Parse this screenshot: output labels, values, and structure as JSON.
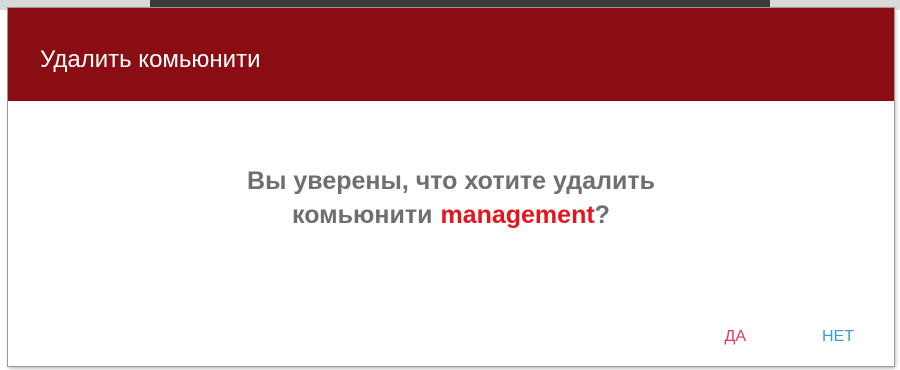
{
  "dialog": {
    "title": "Удалить комьюнити",
    "message_line1": "Вы уверены, что хотите удалить",
    "message_line2_prefix": "комьюнити",
    "community_name": "management",
    "message_suffix": "?",
    "yes_label": "ДА",
    "no_label": "НЕТ"
  },
  "colors": {
    "header_bg": "#8b0d14",
    "accent_text": "#e3151e",
    "yes_button": "#e3356f",
    "no_button": "#3d9bd9"
  }
}
